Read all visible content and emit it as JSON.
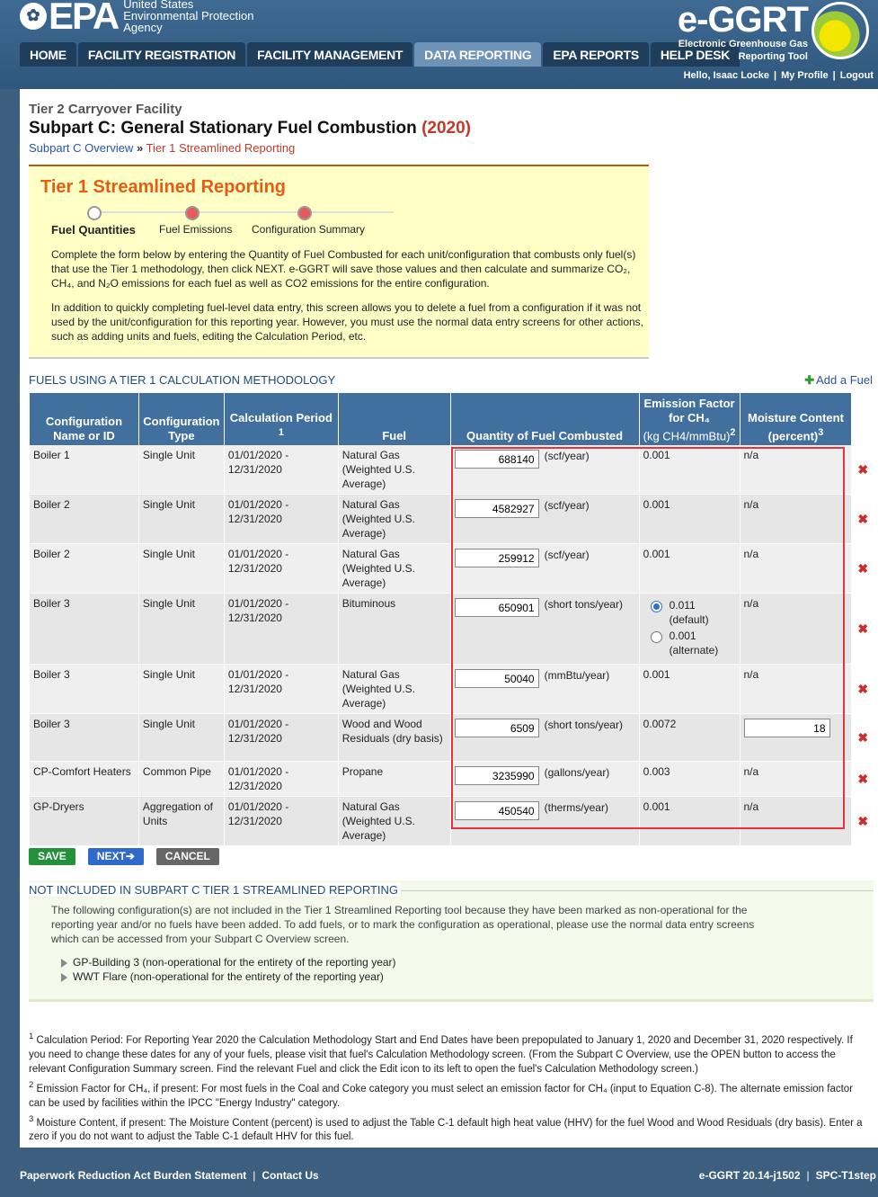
{
  "header": {
    "agency_logo": "EPA",
    "agency_lines": [
      "United States",
      "Environmental Protection",
      "Agency"
    ],
    "app_title": "e-GGRT",
    "app_subtitle": [
      "Electronic Greenhouse Gas",
      "Reporting Tool"
    ],
    "nav_tabs": [
      {
        "label": "HOME",
        "active": false
      },
      {
        "label": "FACILITY REGISTRATION",
        "active": false
      },
      {
        "label": "FACILITY MANAGEMENT",
        "active": false
      },
      {
        "label": "DATA REPORTING",
        "active": true
      },
      {
        "label": "EPA REPORTS",
        "active": false
      },
      {
        "label": "HELP DESK",
        "active": false
      }
    ],
    "user": {
      "greeting": "Hello, Isaac Locke",
      "profile": "My Profile",
      "logout": "Logout"
    }
  },
  "page": {
    "tier_label": "Tier 2 Carryover Facility",
    "title": "Subpart C: General Stationary Fuel Combustion",
    "year": "(2020)",
    "breadcrumb": {
      "link": "Subpart C Overview",
      "separator": "»",
      "current": "Tier 1 Streamlined Reporting"
    }
  },
  "banner": {
    "title": "Tier 1 Streamlined Reporting",
    "steps": [
      {
        "label": "Fuel Quantities",
        "state": "current"
      },
      {
        "label": "Fuel Emissions",
        "state": "future"
      },
      {
        "label": "Configuration Summary",
        "state": "future"
      }
    ],
    "para1": "Complete the form below by entering the Quantity of Fuel Combusted for each unit/configuration that combusts only fuel(s) that use the Tier 1 methodology, then click NEXT. e-GGRT will save those values and then calculate and summarize CO₂, CH₄, and N₂O emissions for each fuel as well as CO2 emissions for the entire configuration.",
    "para2": "In addition to quickly completing fuel-level data entry, this screen allows you to delete a fuel from a configuration if it was not used by the unit/configuration for this reporting year. However, you must use the normal data entry screens for other actions, such as adding units and fuels, editing the Calculation Period, etc."
  },
  "fuels_section": {
    "title": "FUELS USING A TIER 1 CALCULATION METHODOLOGY",
    "add_fuel": "Add a Fuel",
    "columns": {
      "config_name": "Configuration Name or ID",
      "config_type": "Configuration Type",
      "calc_period": "Calculation Period",
      "calc_period_sup": "1",
      "fuel": "Fuel",
      "quantity": "Quantity of Fuel Combusted",
      "emission_factor": "Emission Factor for CH₄",
      "emission_factor_unit": "(kg CH4/mmBtu)",
      "emission_factor_sup": "2",
      "moisture": "Moisture Content",
      "moisture_unit": "(percent)",
      "moisture_sup": "3"
    },
    "rows": [
      {
        "name": "Boiler 1",
        "type": "Single Unit",
        "period": "01/01/2020 - 12/31/2020",
        "fuel": "Natural Gas (Weighted U.S. Average)",
        "qty": "688140",
        "unit": "(scf/year)",
        "ef": "0.001",
        "moisture": "n/a"
      },
      {
        "name": "Boiler 2",
        "type": "Single Unit",
        "period": "01/01/2020 - 12/31/2020",
        "fuel": "Natural Gas (Weighted U.S. Average)",
        "qty": "4582927",
        "unit": "(scf/year)",
        "ef": "0.001",
        "moisture": "n/a"
      },
      {
        "name": "Boiler 2",
        "type": "Single Unit",
        "period": "01/01/2020 - 12/31/2020",
        "fuel": "Natural Gas (Weighted U.S. Average)",
        "qty": "259912",
        "unit": "(scf/year)",
        "ef": "0.001",
        "moisture": "n/a"
      },
      {
        "name": "Boiler 3",
        "type": "Single Unit",
        "period": "01/01/2020 - 12/31/2020",
        "fuel": "Bituminous",
        "qty": "650901",
        "unit": "(short tons/year)",
        "ef_default": "0.011",
        "ef_default_lbl": "(default)",
        "ef_alt": "0.001",
        "ef_alt_lbl": "(alternate)",
        "moisture": "n/a"
      },
      {
        "name": "Boiler 3",
        "type": "Single Unit",
        "period": "01/01/2020 - 12/31/2020",
        "fuel": "Natural Gas (Weighted U.S. Average)",
        "qty": "50040",
        "unit": "(mmBtu/year)",
        "ef": "0.001",
        "moisture": "n/a"
      },
      {
        "name": "Boiler 3",
        "type": "Single Unit",
        "period": "01/01/2020 - 12/31/2020",
        "fuel": "Wood and Wood Residuals (dry basis)",
        "qty": "6509",
        "unit": "(short tons/year)",
        "ef": "0.0072",
        "moisture_value": "18"
      },
      {
        "name": "CP-Comfort Heaters",
        "type": "Common Pipe",
        "period": "01/01/2020 - 12/31/2020",
        "fuel": "Propane",
        "qty": "3235990",
        "unit": "(gallons/year)",
        "ef": "0.003",
        "moisture": "n/a"
      },
      {
        "name": "GP-Dryers",
        "type": "Aggregation of Units",
        "period": "01/01/2020 - 12/31/2020",
        "fuel": "Natural Gas (Weighted U.S. Average)",
        "qty": "450540",
        "unit": "(therms/year)",
        "ef": "0.001",
        "moisture": "n/a"
      }
    ]
  },
  "buttons": {
    "save": "SAVE",
    "next": "NEXT",
    "cancel": "CANCEL"
  },
  "not_included": {
    "title": "NOT INCLUDED IN SUBPART C TIER 1 STREAMLINED REPORTING",
    "text": "The following configuration(s) are not included in the Tier 1 Streamlined Reporting tool because they have been marked as non-operational for the reporting year and/or no fuels have been added. To add fuels, or to mark the configuration as operational, please use the normal data entry screens which can be accessed from your Subpart C Overview screen.",
    "items": [
      "GP-Building 3 (non-operational for the entirety of the reporting year)",
      "WWT Flare (non-operational for the entirety of the reporting year)"
    ]
  },
  "footnotes": [
    {
      "sup": "1",
      "text": "Calculation Period: For Reporting Year 2020 the Calculation Methodology Start and End Dates have been prepopulated to January 1, 2020 and December 31, 2020 respectively. If you need to change these dates for any of your fuels, please visit that fuel's Calculation Methodology screen. (From the Subpart C Overview, use the OPEN button to access the relevant Configuration Summary screen. Find the relevant Fuel and click the Edit icon to its left to open the fuel's Calculation Methodology screen.)"
    },
    {
      "sup": "2",
      "text": "Emission Factor for CH₄, if present: For most fuels in the Coal and Coke category you must select an emission factor for CH₄ (input to Equation C-8). The alternate emission factor can be used by facilities within the IPCC \"Energy Industry\" category."
    },
    {
      "sup": "3",
      "text": "Moisture Content, if present: The Moisture Content (percent) is used to adjust the Table C-1 default high heat value (HHV) for the fuel Wood and Wood Residuals (dry basis). Enter a zero if you do not want to adjust the Table C-1 default HHV for this fuel."
    }
  ],
  "footer": {
    "left": [
      "Paperwork Reduction Act Burden Statement",
      "Contact Us"
    ],
    "right": [
      "e-GGRT 20.14-j1502",
      "SPC-T1step"
    ]
  }
}
